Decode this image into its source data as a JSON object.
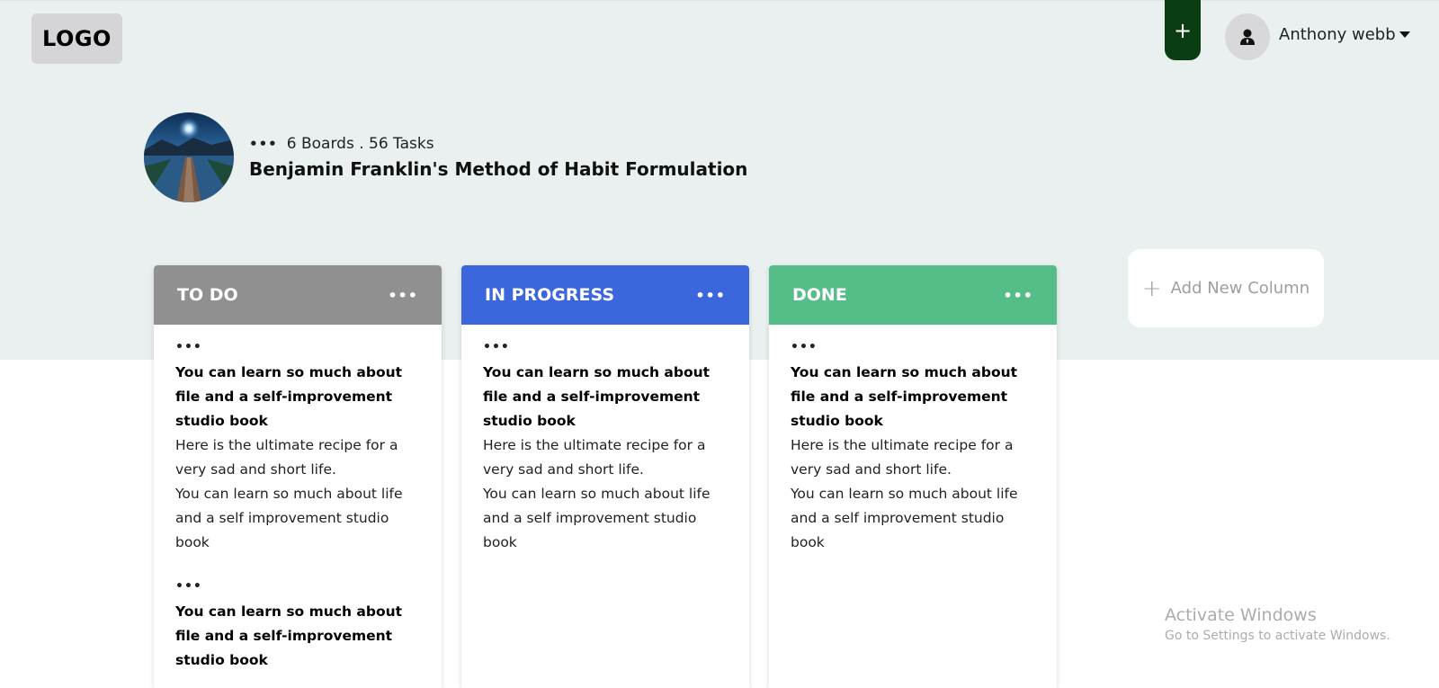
{
  "header": {
    "logo_text": "LOGO",
    "add_button_label": "+",
    "user_name": "Anthony webb",
    "user_dropdown_icon": "caret-down-icon",
    "avatar_icon": "user-icon"
  },
  "board": {
    "meta_dots": "•••",
    "stats": "6 Boards . 56 Tasks",
    "title": "Benjamin Franklin's Method of Habit Formulation"
  },
  "columns": [
    {
      "title": "TO DO",
      "color": "#909090",
      "menu": "•••",
      "cards": [
        {
          "menu": "•••",
          "title": "You can learn so much about file and a self-improvement studio book",
          "text1": "Here is the ultimate recipe for a very sad and short life.",
          "text2": "You can learn so much about life and a self improvement studio book"
        },
        {
          "menu": "•••",
          "title": "You can learn so much about file and a self-improvement studio book"
        }
      ]
    },
    {
      "title": "IN PROGRESS",
      "color": "#3c66dc",
      "menu": "•••",
      "cards": [
        {
          "menu": "•••",
          "title": "You can learn so much about file and a self-improvement studio book",
          "text1": "Here is the ultimate recipe for a very sad and short life.",
          "text2": "You can learn so much about life and a self improvement studio book"
        }
      ]
    },
    {
      "title": "DONE",
      "color": "#55bd88",
      "menu": "•••",
      "cards": [
        {
          "menu": "•••",
          "title": "You can learn so much about file and a self-improvement studio book",
          "text1": "Here is the ultimate recipe for a very sad and short life.",
          "text2": "You can learn so much about life and a self improvement studio book"
        }
      ]
    }
  ],
  "add_column": {
    "icon": "plus-icon",
    "label": "Add New Column"
  },
  "watermark": {
    "line1": "Activate Windows",
    "line2": "Go to Settings to activate Windows."
  },
  "colors": {
    "header_band": "#eaf0f0",
    "add_button": "#0b3d12"
  }
}
